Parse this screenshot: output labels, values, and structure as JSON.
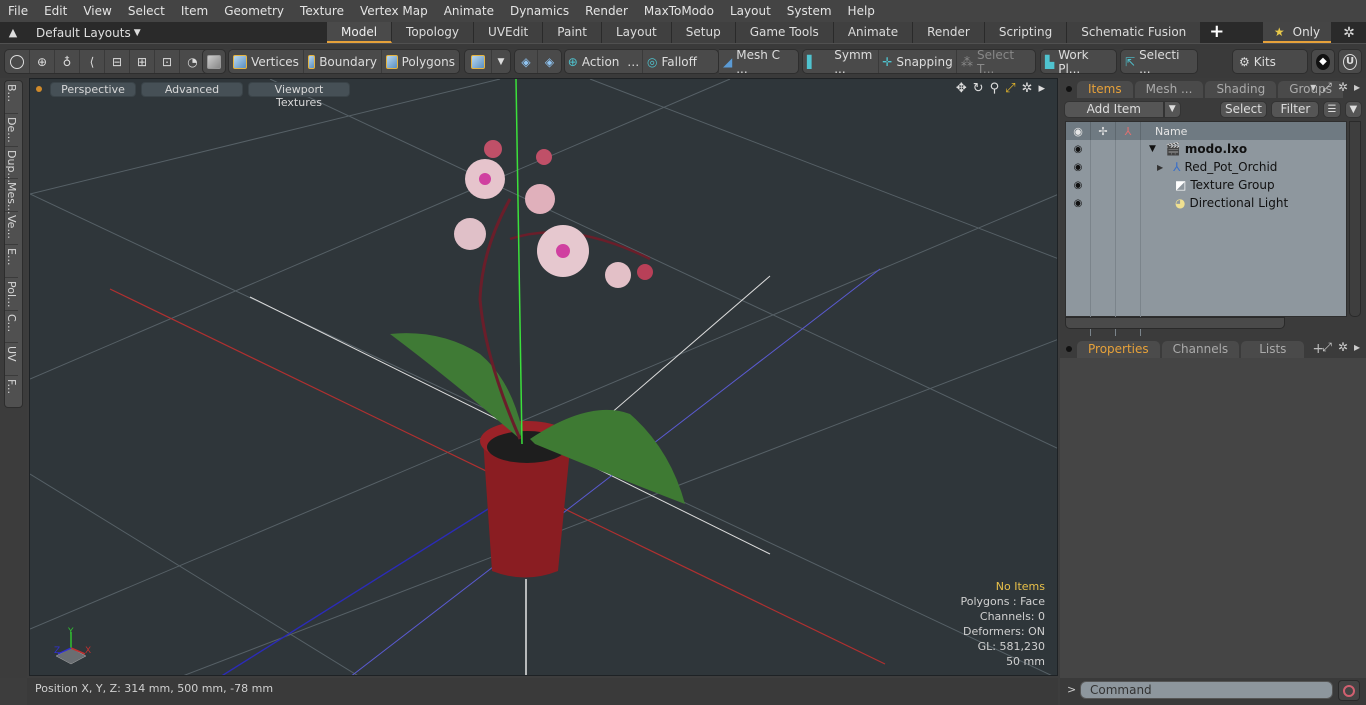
{
  "menu": [
    "File",
    "Edit",
    "View",
    "Select",
    "Item",
    "Geometry",
    "Texture",
    "Vertex Map",
    "Animate",
    "Dynamics",
    "Render",
    "MaxToModo",
    "Layout",
    "System",
    "Help"
  ],
  "layouts": {
    "label": "Default Layouts"
  },
  "tabs": [
    "Model",
    "Topology",
    "UVEdit",
    "Paint",
    "Layout",
    "Setup",
    "Game Tools",
    "Animate",
    "Render",
    "Scripting",
    "Schematic Fusion"
  ],
  "active_tab": "Model",
  "only_tab": "Only",
  "toolbar": {
    "vertices": "Vertices",
    "boundary": "Boundary",
    "polygons": "Polygons",
    "action": "Action",
    "falloff": "Falloff",
    "mesh_c": "Mesh C ...",
    "symm": "Symm ...",
    "snapping": "Snapping",
    "select_t": "Select T...",
    "work_pl": "Work Pl...",
    "selecti": "Selecti ...",
    "kits": "Kits"
  },
  "left_tabs": [
    "B...",
    "De...",
    "Dup...",
    "Mes...",
    "Ve...",
    "E...",
    "Pol...",
    "C...",
    "UV",
    "F..."
  ],
  "viewport": {
    "perspective": "Perspective",
    "advanced": "Advanced",
    "textures": "Viewport Textures",
    "info": {
      "selection": "No Items",
      "polygons": "Polygons : Face",
      "channels": "Channels: 0",
      "deformers": "Deformers: ON",
      "gl": "GL: 581,230",
      "scale": "50 mm"
    },
    "axis_labels": {
      "x": "X",
      "y": "Y",
      "z": "Z"
    }
  },
  "status": {
    "position": "Position X, Y, Z:   314 mm, 500 mm, -78 mm"
  },
  "items_panel": {
    "tabs": [
      "Items",
      "Mesh ...",
      "Shading",
      "Groups"
    ],
    "add_item": "Add Item",
    "select": "Select",
    "filter": "Filter",
    "column_name": "Name",
    "rows": [
      {
        "name": "modo.lxo",
        "icon": "scene-icon",
        "bold": true,
        "indent": 0
      },
      {
        "name": "Red_Pot_Orchid",
        "icon": "mesh-locator-icon",
        "bold": false,
        "indent": 1
      },
      {
        "name": "Texture Group",
        "icon": "texture-group-icon",
        "bold": false,
        "indent": 1
      },
      {
        "name": "Directional Light",
        "icon": "light-icon",
        "bold": false,
        "indent": 1
      }
    ]
  },
  "props_panel": {
    "tabs": [
      "Properties",
      "Channels",
      "Lists"
    ]
  },
  "command": {
    "placeholder": "Command",
    "prompt": ">"
  },
  "colors": {
    "accent": "#e6a13a",
    "highlight_text": "#e8c04a",
    "viewport_bg": "#2f363a",
    "x_axis": "#c03030",
    "y_axis": "#30d030",
    "z_axis": "#3030c0"
  }
}
